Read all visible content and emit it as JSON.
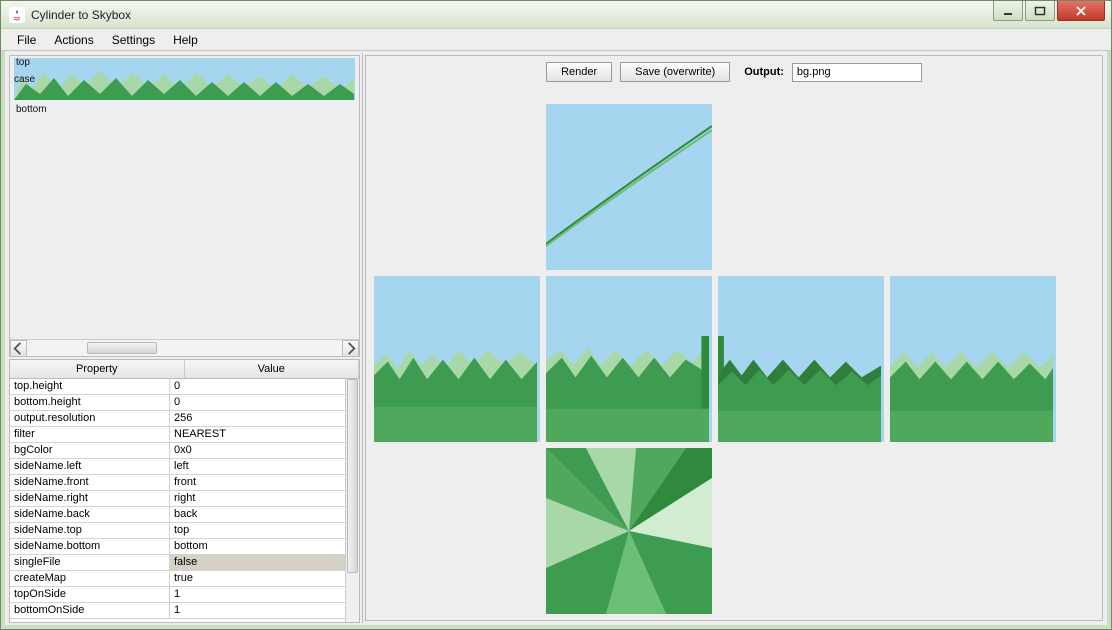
{
  "window": {
    "title": "Cylinder to Skybox"
  },
  "menu": {
    "file": "File",
    "actions": "Actions",
    "settings": "Settings",
    "help": "Help"
  },
  "preview": {
    "top": "top",
    "case": "case",
    "bottom": "bottom"
  },
  "propHeaders": {
    "property": "Property",
    "value": "Value"
  },
  "properties": [
    {
      "key": "top.height",
      "value": "0"
    },
    {
      "key": "bottom.height",
      "value": "0"
    },
    {
      "key": "output.resolution",
      "value": "256"
    },
    {
      "key": "filter",
      "value": "NEAREST"
    },
    {
      "key": "bgColor",
      "value": "0x0"
    },
    {
      "key": "sideName.left",
      "value": "left"
    },
    {
      "key": "sideName.front",
      "value": "front"
    },
    {
      "key": "sideName.right",
      "value": "right"
    },
    {
      "key": "sideName.back",
      "value": "back"
    },
    {
      "key": "sideName.top",
      "value": "top"
    },
    {
      "key": "sideName.bottom",
      "value": "bottom"
    },
    {
      "key": "singleFile",
      "value": "false",
      "selected": true
    },
    {
      "key": "createMap",
      "value": "true"
    },
    {
      "key": "topOnSide",
      "value": "1"
    },
    {
      "key": "bottomOnSide",
      "value": "1"
    }
  ],
  "toolbar": {
    "render": "Render",
    "save": "Save (overwrite)",
    "outputLabel": "Output:",
    "outputValue": "bg.png"
  }
}
